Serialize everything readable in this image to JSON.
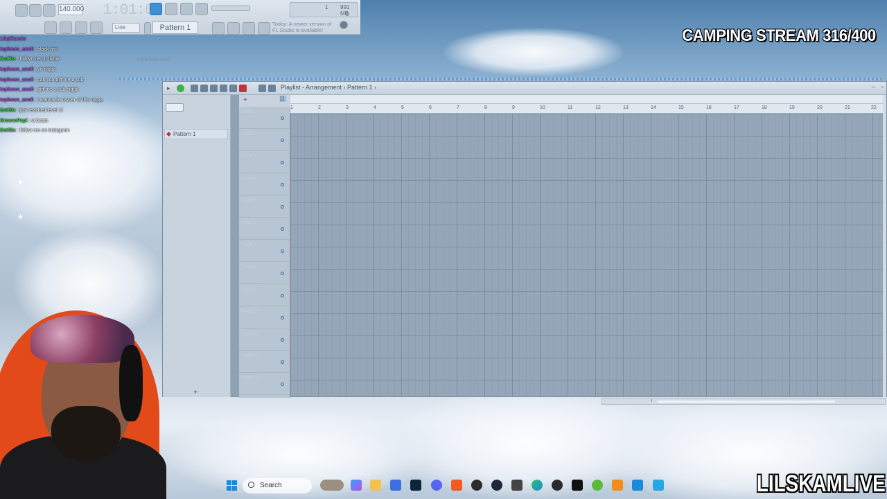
{
  "toolbar": {
    "tempo": "140.000",
    "time": "1:01:00",
    "meter_cpu": "1",
    "meter_mem": "991 MB",
    "meter_poly": "0",
    "pattern_selector": "Pattern 1",
    "snap": "Line",
    "news_line1": "Today: A newer version of",
    "news_line2": "FL Studio is available!"
  },
  "chat": [
    {
      "user": "LilqSkamlo",
      "text": ""
    },
    {
      "user": "tophoon_anoli",
      "text": "black ass"
    },
    {
      "user": "",
      "text": ""
    },
    {
      "user": "BotRix",
      "text": "follow me on tiktok"
    },
    {
      "user": "tophoon_anoli",
      "text": "yo nigga"
    },
    {
      "user": "tophoon_anoli",
      "text": "can you gift me a sub"
    },
    {
      "user": "tophoon_anoli",
      "text": "gift me a sub nigga"
    },
    {
      "user": "tophoon_anoli",
      "text": "i wanna be owner of this nigga"
    },
    {
      "user": "BotRix",
      "text": "just reached level 1!"
    },
    {
      "user": "GroovePapi",
      "text": "w beats"
    },
    {
      "user": "BotRix",
      "text": "follow me on instagram"
    }
  ],
  "channel_rack": "Channel rack",
  "playlist": {
    "breadcrumb": "Playlist - Arrangement › Pattern 1 ›",
    "pattern_item": "Pattern 1",
    "tracks": [
      "Track 1",
      "Track 2",
      "Track 3",
      "Track 4",
      "Track 5",
      "Track 6",
      "Track 7",
      "Track 8",
      "Track 9",
      "Track 10",
      "Track 11",
      "Track 12",
      "Track 13"
    ],
    "bars": [
      "1",
      "2",
      "3",
      "4",
      "5",
      "6",
      "7",
      "8",
      "9",
      "10",
      "11",
      "12",
      "13",
      "14",
      "15",
      "16",
      "17",
      "18",
      "19",
      "20",
      "21",
      "22"
    ]
  },
  "overlay": {
    "stream_title": "CAMPING STREAM 316/400",
    "brand": "LILSKAMLIVE"
  },
  "taskbar": {
    "search": "Search",
    "icons": [
      "windows-icon",
      "cat-icon",
      "copilot-icon",
      "folder-icon",
      "store-icon",
      "photoshop-icon",
      "discord-icon",
      "brave-icon",
      "obs-icon",
      "steam-icon",
      "app-icon",
      "edge-icon",
      "4k-icon",
      "capcut-icon",
      "utorrent-icon",
      "fl-studio-icon",
      "pen-icon",
      "notepad-icon"
    ]
  },
  "colors": {
    "accent": "#3d8fd6",
    "playlist_bg": "#94a6b8",
    "webcam_light": "#e24a1a"
  }
}
